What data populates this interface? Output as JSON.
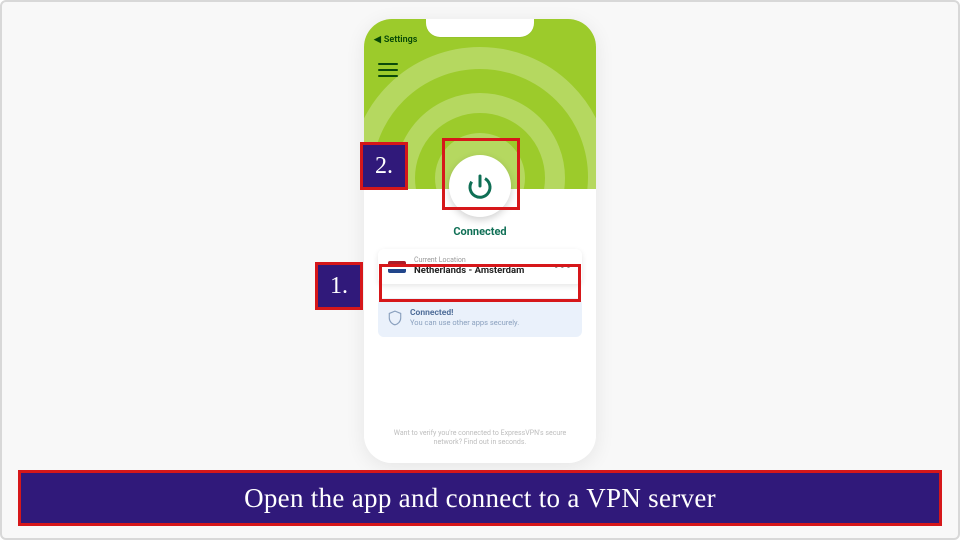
{
  "statusbar": {
    "back_label": "Settings"
  },
  "power": {
    "status": "Connected"
  },
  "location": {
    "label": "Current Location",
    "value": "Netherlands - Amsterdam",
    "more": "•••"
  },
  "secure": {
    "title": "Connected!",
    "subtitle": "You can use other apps securely."
  },
  "footer": {
    "text": "Want to verify you're connected to ExpressVPN's secure network? Find out in seconds."
  },
  "callouts": {
    "step1": "1.",
    "step2": "2."
  },
  "banner": {
    "text": "Open the app and connect to a VPN server"
  },
  "colors": {
    "accent_green": "#9ccb2b",
    "callout_purple": "#30197a",
    "highlight_red": "#d6171a",
    "power_icon": "#0f6f55"
  }
}
